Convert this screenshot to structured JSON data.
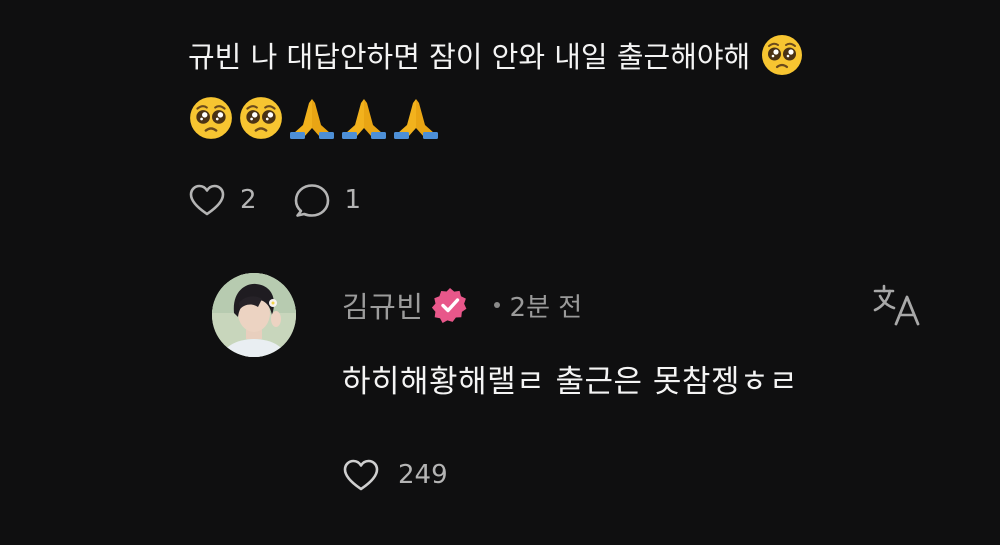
{
  "post": {
    "text": "규빈 나 대답안하면 잠이 안와 내일 출근해야해",
    "trailing_emoji": "pleading-face-emoji",
    "emoji_line": [
      "pleading-face-emoji",
      "pleading-face-emoji",
      "folded-hands-emoji",
      "folded-hands-emoji",
      "folded-hands-emoji"
    ],
    "like_count": "2",
    "reply_count": "1"
  },
  "reply": {
    "username": "김규빈",
    "verified": true,
    "timestamp": "2분 전",
    "text": "하히해황해랠ㄹ 출근은 못참젱ㅎㄹ",
    "like_count": "249"
  },
  "colors": {
    "background": "#0f0f10",
    "text_primary": "#f4f4f4",
    "text_secondary": "#9c9c9c",
    "verified_badge": "#e8578a",
    "emoji_face": "#f7c531",
    "emoji_hands": "#f2b21d"
  }
}
